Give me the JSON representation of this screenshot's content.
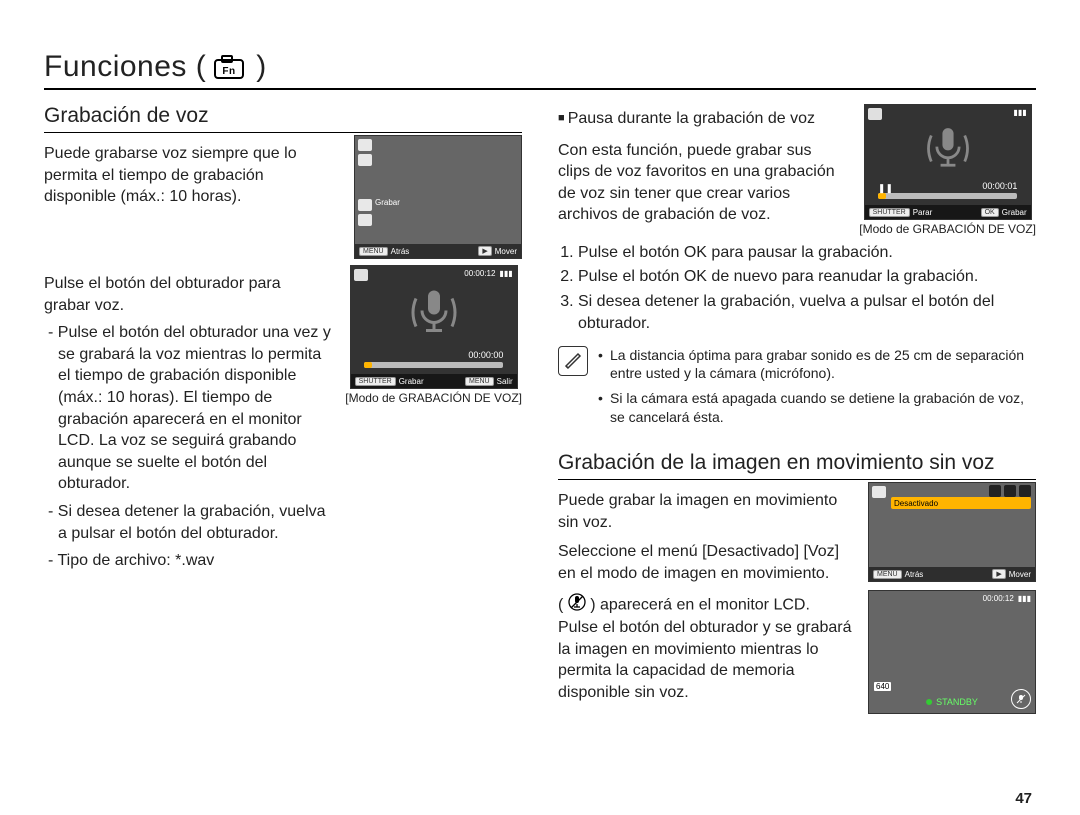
{
  "page_number": "47",
  "title": "Funciones (",
  "title_suffix": ")",
  "left": {
    "heading": "Grabación de voz",
    "intro": "Puede grabarse voz siempre que lo permita el tiempo de grabación disponible (máx.: 10 horas).",
    "mid": "Pulse el botón del obturador para grabar voz.",
    "bullets": [
      "Pulse el botón del obturador una vez y se grabará la voz mientras lo permita el tiempo de grabación disponible (máx.: 10 horas). El tiempo de grabación aparecerá en el monitor LCD. La voz se seguirá grabando aunque se suelte el botón del obturador.",
      "Si desea detener la grabación, vuelva a pulsar el botón del obturador.",
      "Tipo de archivo: *.wav"
    ],
    "shot1": {
      "bottom_left_label": "Grabar",
      "menu_badge": "MENU",
      "back_label": "Atrás",
      "move_badge": "",
      "move_label": "Mover"
    },
    "shot2": {
      "time_top": "00:00:12",
      "timer": "00:00:00",
      "shutter_badge": "SHUTTER",
      "shutter_label": "Grabar",
      "menu_badge": "MENU",
      "exit_label": "Salir"
    },
    "caption2": "[Modo de GRABACIÓN DE VOZ]"
  },
  "right": {
    "pause_heading": "Pausa durante la grabación de voz",
    "pause_intro": "Con esta función, puede grabar sus clips de voz favoritos en una grabación de voz sin tener que crear varios archivos de grabación de voz.",
    "shot_pause": {
      "timer": "00:00:01",
      "shutter_badge": "SHUTTER",
      "stop_label": "Parar",
      "ok_badge": "OK",
      "rec_label": "Grabar"
    },
    "caption_pause": "[Modo de GRABACIÓN DE VOZ]",
    "steps": [
      "Pulse el botón OK para pausar la grabación.",
      "Pulse el botón OK de nuevo para reanudar la grabación.",
      "Si desea detener la grabación, vuelva a pulsar el botón del obturador."
    ],
    "notes": [
      "La distancia óptima para grabar sonido es de 25 cm de separación entre usted y la cámara (micrófono).",
      "Si la cámara está apagada cuando se detiene la grabación de voz, se cancelará ésta."
    ],
    "mov_heading": "Grabación de la imagen en movimiento sin voz",
    "mov_p1": "Puede grabar la imagen en movimiento sin voz.",
    "mov_p2": "Seleccione el menú [Desactivado] [Voz] en el modo de imagen en movimiento.",
    "mov_p3_a": "( ",
    "mov_p3_b": " ) aparecerá en el monitor LCD. Pulse el botón del obturador y se grabará la imagen en movimiento mientras lo permita la capacidad de memoria disponible sin voz.",
    "shot_menu": {
      "highlight": "Desactivado",
      "menu_badge": "MENU",
      "back_label": "Atrás",
      "move_label": "Mover"
    },
    "shot_standby": {
      "time": "00:00:12",
      "res": "640",
      "standby": "STANDBY"
    }
  }
}
